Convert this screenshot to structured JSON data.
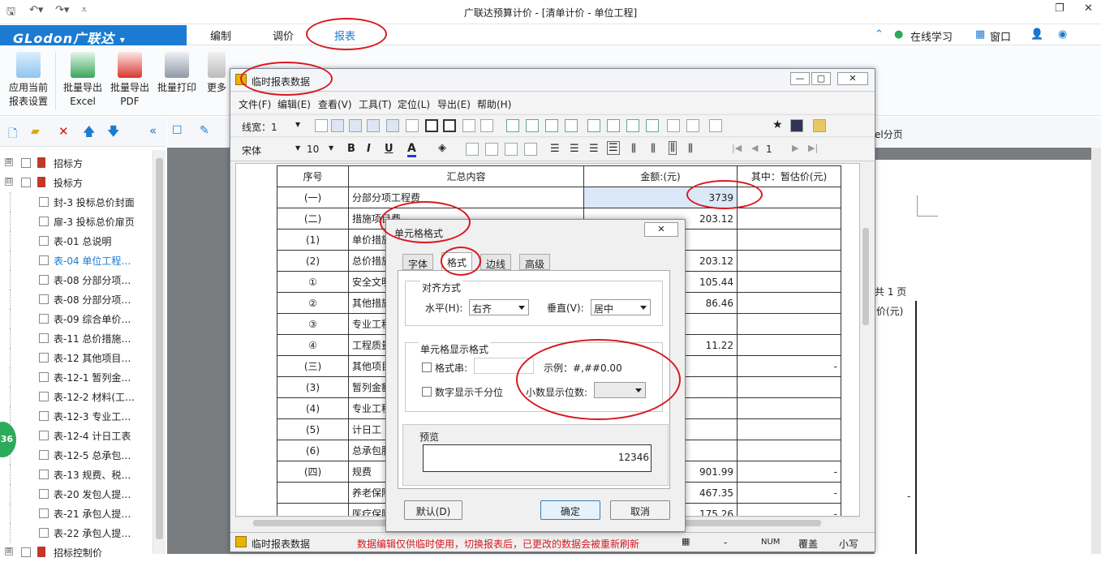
{
  "app": {
    "title": "广联达预算计价 - [清单计价 - 单位工程]",
    "logo": "GLodon广联达",
    "logo_arrow": "▾"
  },
  "menu": {
    "items": [
      "编制",
      "调价",
      "报表"
    ],
    "online": "在线学习",
    "window": "窗口"
  },
  "ribbon": {
    "buttons": [
      {
        "l1": "应用当前",
        "l2": "报表设置"
      },
      {
        "l1": "批量导出",
        "l2": "Excel"
      },
      {
        "l1": "批量导出",
        "l2": "PDF"
      },
      {
        "l1": "批量打印",
        "l2": ""
      },
      {
        "l1": "更多",
        "l2": ""
      }
    ]
  },
  "tree": {
    "items": [
      {
        "label": "招标方",
        "level": 0,
        "plus": "⊞"
      },
      {
        "label": "投标方",
        "level": 0,
        "plus": "⊟"
      },
      {
        "label": "封-3 投标总价封面",
        "level": 1
      },
      {
        "label": "扉-3 投标总价扉页",
        "level": 1
      },
      {
        "label": "表-01 总说明",
        "level": 1
      },
      {
        "label": "表-04 单位工程…",
        "level": 1,
        "active": true
      },
      {
        "label": "表-08 分部分项…",
        "level": 1
      },
      {
        "label": "表-08 分部分项…",
        "level": 1
      },
      {
        "label": "表-09 综合单价…",
        "level": 1
      },
      {
        "label": "表-11 总价措施…",
        "level": 1
      },
      {
        "label": "表-12 其他项目…",
        "level": 1
      },
      {
        "label": "表-12-1 暂列金…",
        "level": 1
      },
      {
        "label": "表-12-2 材料(工…",
        "level": 1
      },
      {
        "label": "表-12-3 专业工…",
        "level": 1
      },
      {
        "label": "表-12-4 计日工表",
        "level": 1
      },
      {
        "label": "表-12-5 总承包…",
        "level": 1
      },
      {
        "label": "表-13 规费、税…",
        "level": 1
      },
      {
        "label": "表-20 发包人提…",
        "level": 1
      },
      {
        "label": "表-21 承包人提…",
        "level": 1
      },
      {
        "label": "表-22 承包人提…",
        "level": 1
      },
      {
        "label": "招标控制价",
        "level": 0,
        "plus": "⊞"
      }
    ],
    "badge": "36"
  },
  "background": {
    "page_label": "共 1 页",
    "col_label": "价(元)",
    "split_label": "el分页"
  },
  "temp_window": {
    "title": "临时报表数据",
    "menu": [
      "文件(F)",
      "编辑(E)",
      "查看(V)",
      "工具(T)",
      "定位(L)",
      "导出(E)",
      "帮助(H)"
    ],
    "line_width_label": "线宽：1",
    "font": "宋体",
    "font_size": "10",
    "page_num": "1",
    "table_header": [
      "序号",
      "汇总内容",
      "金额:(元)",
      "其中：暂估价(元)"
    ],
    "rows": [
      [
        "(一)",
        "分部分项工程费",
        "3739",
        ""
      ],
      [
        "(二)",
        "措施项目费",
        "203.12",
        ""
      ],
      [
        "(1)",
        "单价措施",
        "",
        ""
      ],
      [
        "(2)",
        "总价措施",
        "203.12",
        ""
      ],
      [
        "①",
        "安全文明",
        "105.44",
        ""
      ],
      [
        "②",
        "其他措施",
        "86.46",
        ""
      ],
      [
        "③",
        "专业工程",
        "",
        ""
      ],
      [
        "④",
        "工程质量",
        "11.22",
        ""
      ],
      [
        "(三)",
        "其他项目",
        "",
        "-"
      ],
      [
        "(3)",
        "暂列金额",
        "",
        ""
      ],
      [
        "(4)",
        "专业工程",
        "",
        ""
      ],
      [
        "(5)",
        "计日工",
        "",
        ""
      ],
      [
        "(6)",
        "总承包服",
        "",
        ""
      ],
      [
        "(四)",
        "规费",
        "901.99",
        "-"
      ],
      [
        "",
        "养老保险",
        "467.35",
        "-"
      ],
      [
        "",
        "医疗保险",
        "175.26",
        "-"
      ]
    ],
    "status": {
      "name": "临时报表数据",
      "msg": "数据编辑仅供临时使用，切换报表后，已更改的数据会被重新刷新",
      "s1": "-",
      "s2": "NUM",
      "s3": "覆盖",
      "s4": "小写"
    }
  },
  "cell_format": {
    "title": "单元格格式",
    "tabs": [
      "字体",
      "格式",
      "边线",
      "高级"
    ],
    "align_group": "对齐方式",
    "h_label": "水平(H):",
    "h_value": "右齐",
    "v_label": "垂直(V):",
    "v_value": "居中",
    "display_group": "单元格显示格式",
    "fmt_label": "格式串:",
    "fmt_value": "",
    "example": "示例：#,##0.00",
    "thousands_label": "数字显示千分位",
    "decimals_label": "小数显示位数:",
    "decimals_value": "",
    "preview_group": "预览",
    "preview_value": "12346",
    "default_btn": "默认(D)",
    "ok_btn": "确定",
    "cancel_btn": "取消"
  },
  "colors": {
    "accent": "#1b7bd2",
    "annotation": "#d71920",
    "status_msg": "#d71920"
  }
}
